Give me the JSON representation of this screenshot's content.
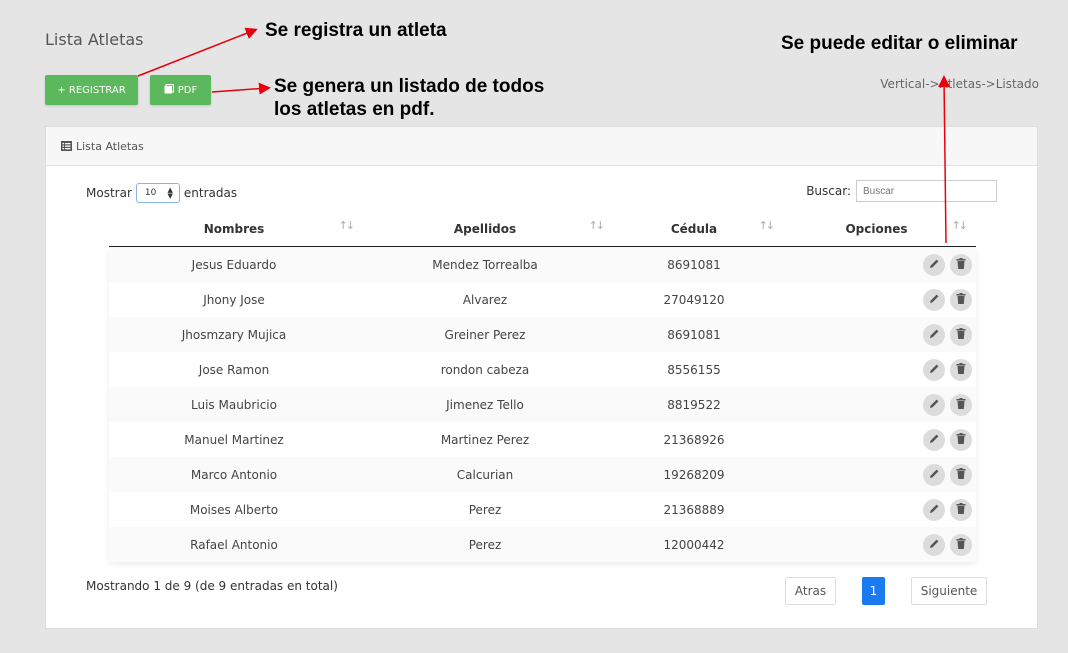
{
  "page": {
    "title": "Lista Atletas",
    "breadcrumb": "Vertical->Atletas->Listado"
  },
  "toolbar": {
    "register_label": "+ REGISTRAR",
    "pdf_label": "PDF"
  },
  "annotations": {
    "register": "Se registra un atleta",
    "pdf_line1": "Se genera un listado de todos",
    "pdf_line2": "los atletas en pdf.",
    "options": "Se puede editar o eliminar",
    "arrow_color": "#e8000b"
  },
  "card": {
    "header": "Lista Atletas"
  },
  "controls": {
    "show_label": "Mostrar",
    "page_size": "10",
    "entries_label": "entradas",
    "search_label": "Buscar:",
    "search_placeholder": "Buscar"
  },
  "table": {
    "columns": [
      "Nombres",
      "Apellidos",
      "Cédula",
      "Opciones"
    ],
    "rows": [
      [
        "Jesus Eduardo",
        "Mendez Torrealba",
        "8691081"
      ],
      [
        "Jhony Jose",
        "Alvarez",
        "27049120"
      ],
      [
        "Jhosmzary Mujica",
        "Greiner Perez",
        "8691081"
      ],
      [
        "Jose Ramon",
        "rondon cabeza",
        "8556155"
      ],
      [
        "Luis Maubricio",
        "Jimenez Tello",
        "8819522"
      ],
      [
        "Manuel Martinez",
        "Martinez Perez",
        "21368926"
      ],
      [
        "Marco Antonio",
        "Calcurian",
        "19268209"
      ],
      [
        "Moises Alberto",
        "Perez",
        "21368889"
      ],
      [
        "Rafael Antonio",
        "Perez",
        "12000442"
      ]
    ],
    "row_actions": [
      "edit-icon",
      "trash-icon"
    ]
  },
  "footer": {
    "info": "Mostrando 1 de 9 (de 9 entradas en total)",
    "prev_label": "Atras",
    "current_page": "1",
    "next_label": "Siguiente"
  },
  "colors": {
    "accent_green": "#5cb85c",
    "pager_active": "#1a7bf0",
    "background": "#e5e5e5"
  }
}
